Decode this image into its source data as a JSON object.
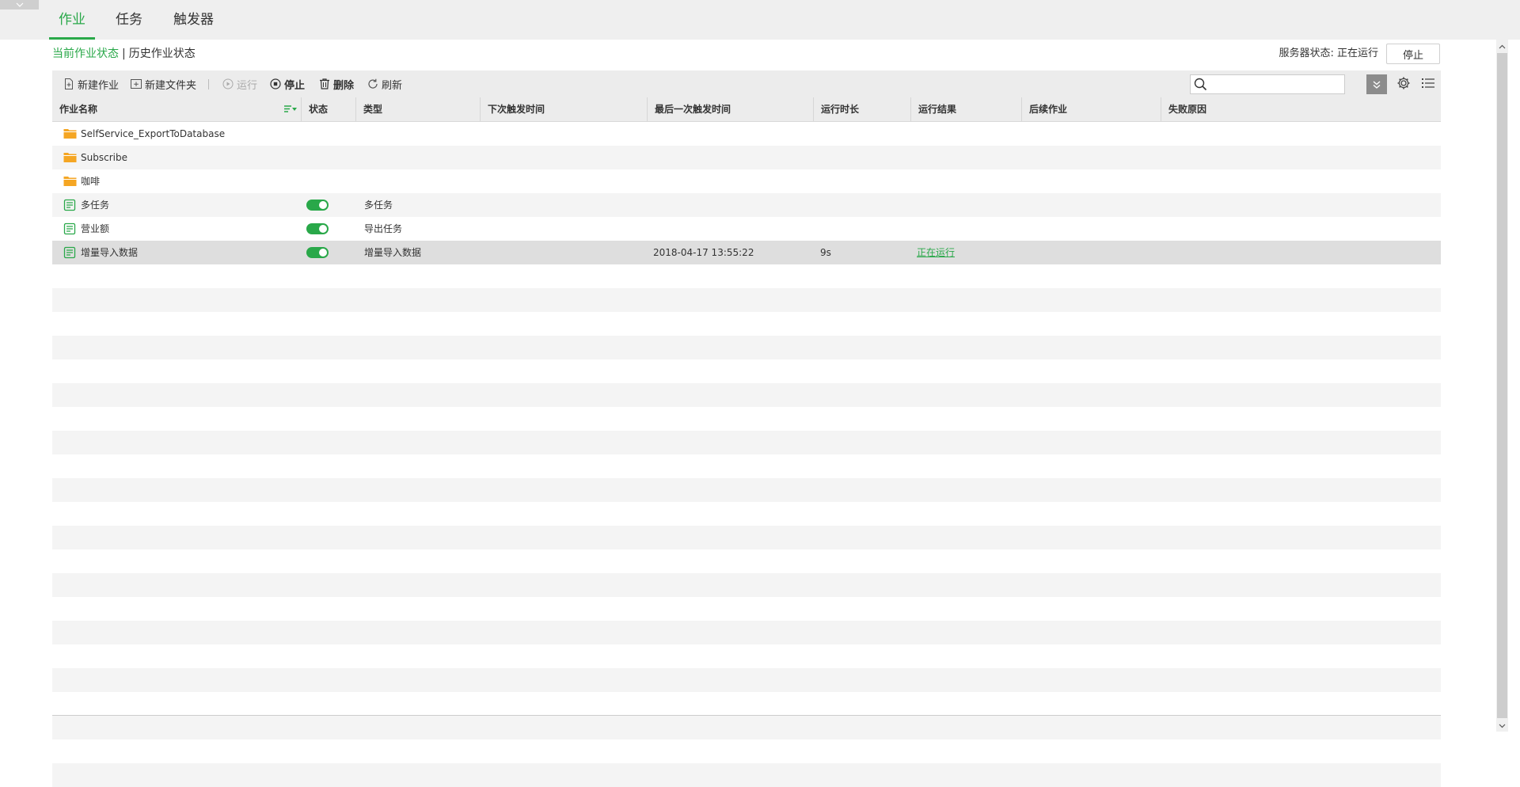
{
  "top_tabs": [
    {
      "label": "作业",
      "active": true
    },
    {
      "label": "任务",
      "active": false
    },
    {
      "label": "触发器",
      "active": false
    }
  ],
  "status_links": {
    "current": "当前作业状态",
    "separator": "|",
    "history": "历史作业状态"
  },
  "server": {
    "status_label": "服务器状态:",
    "status_value": "正在运行",
    "stop_button": "停止"
  },
  "toolbar": {
    "new_job": "新建作业",
    "new_folder": "新建文件夹",
    "run": "运行",
    "stop": "停止",
    "delete": "删除",
    "refresh": "刷新"
  },
  "search": {
    "placeholder": "",
    "value": ""
  },
  "columns": [
    "作业名称",
    "状态",
    "类型",
    "下次触发时间",
    "最后一次触发时间",
    "运行时长",
    "运行结果",
    "后续作业",
    "失败原因"
  ],
  "rows": [
    {
      "icon": "folder-icon",
      "name": "SelfService_ExportToDatabase",
      "enabled": null,
      "type": "",
      "last_trigger": "",
      "duration": "",
      "result": ""
    },
    {
      "icon": "folder-icon",
      "name": "Subscribe",
      "enabled": null,
      "type": "",
      "last_trigger": "",
      "duration": "",
      "result": ""
    },
    {
      "icon": "folder-icon",
      "name": "咖啡",
      "enabled": null,
      "type": "",
      "last_trigger": "",
      "duration": "",
      "result": ""
    },
    {
      "icon": "job-icon",
      "name": "多任务",
      "enabled": true,
      "type": "多任务",
      "last_trigger": "",
      "duration": "",
      "result": ""
    },
    {
      "icon": "job-icon",
      "name": "营业额",
      "enabled": true,
      "type": "导出任务",
      "last_trigger": "",
      "duration": "",
      "result": ""
    },
    {
      "icon": "job-icon",
      "name": "增量导入数据",
      "enabled": true,
      "type": "增量导入数据",
      "last_trigger": "2018-04-17 13:55:22",
      "duration": "9s",
      "result": "正在运行",
      "selected": true
    }
  ],
  "colors": {
    "accent": "#29a849",
    "header_bg": "#ececec",
    "top_bg": "#efefef",
    "folder": "#f5a623"
  }
}
